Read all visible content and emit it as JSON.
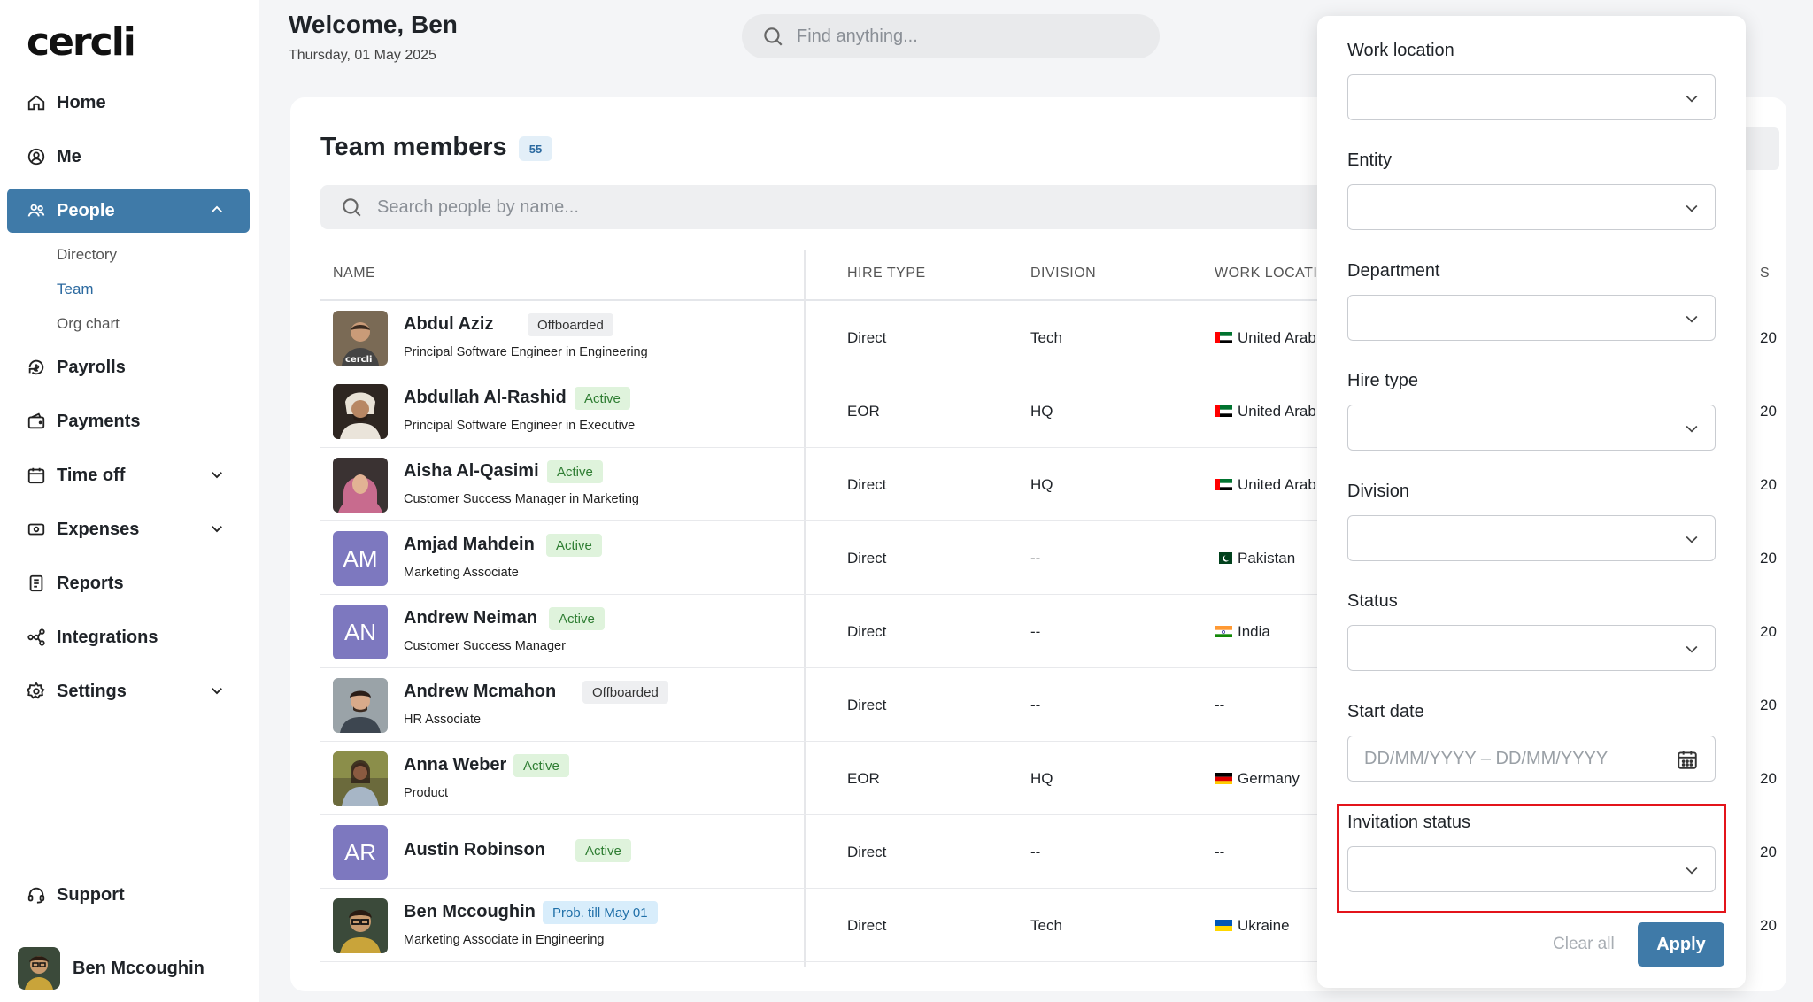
{
  "app": {
    "logo": "cercli"
  },
  "sidebar": {
    "items": [
      {
        "label": "Home",
        "icon": "home-icon"
      },
      {
        "label": "Me",
        "icon": "user-circle-icon"
      },
      {
        "label": "People",
        "icon": "people-icon"
      },
      {
        "label": "Payrolls",
        "icon": "payroll-icon"
      },
      {
        "label": "Payments",
        "icon": "wallet-icon"
      },
      {
        "label": "Time off",
        "icon": "calendar-icon"
      },
      {
        "label": "Expenses",
        "icon": "receipt-icon"
      },
      {
        "label": "Reports",
        "icon": "report-icon"
      },
      {
        "label": "Integrations",
        "icon": "integrations-icon"
      },
      {
        "label": "Settings",
        "icon": "gear-icon"
      },
      {
        "label": "Support",
        "icon": "headset-icon"
      }
    ],
    "people_sub": [
      "Directory",
      "Team",
      "Org chart"
    ],
    "user_name": "Ben Mccoughin"
  },
  "header": {
    "welcome": "Welcome, Ben",
    "date": "Thursday, 01 May 2025",
    "search_placeholder": "Find anything..."
  },
  "team": {
    "title": "Team members",
    "count": "55",
    "search_placeholder": "Search people by name...",
    "columns": [
      "NAME",
      "HIRE TYPE",
      "DIVISION",
      "WORK LOCATION",
      "S"
    ],
    "rows": [
      {
        "name": "Abdul Aziz",
        "status": "Offboarded",
        "role": "Principal Software Engineer in Engineering",
        "hire": "Direct",
        "division": "Tech",
        "location": "United Arab Emirates",
        "flag": "ae",
        "edge": "20"
      },
      {
        "name": "Abdullah Al-Rashid",
        "status": "Active",
        "role": "Principal Software Engineer in Executive",
        "hire": "EOR",
        "division": "HQ",
        "location": "United Arab Emirates",
        "flag": "ae",
        "edge": "20"
      },
      {
        "name": "Aisha Al-Qasimi",
        "status": "Active",
        "role": "Customer Success Manager in Marketing",
        "hire": "Direct",
        "division": "HQ",
        "location": "United Arab Emirates",
        "flag": "ae",
        "edge": "20"
      },
      {
        "name": "Amjad Mahdein",
        "initials": "AM",
        "status": "Active",
        "role": "Marketing Associate",
        "hire": "Direct",
        "division": "--",
        "location": "Pakistan",
        "flag": "pk",
        "edge": "20"
      },
      {
        "name": "Andrew Neiman",
        "initials": "AN",
        "status": "Active",
        "role": "Customer Success Manager",
        "hire": "Direct",
        "division": "--",
        "location": "India",
        "flag": "in",
        "edge": "20"
      },
      {
        "name": "Andrew Mcmahon",
        "status": "Offboarded",
        "role": "HR Associate",
        "hire": "Direct",
        "division": "--",
        "location": "--",
        "flag": "",
        "edge": "20"
      },
      {
        "name": "Anna Weber",
        "status": "Active",
        "role": "Product",
        "hire": "EOR",
        "division": "HQ",
        "location": "Germany",
        "flag": "de",
        "edge": "20"
      },
      {
        "name": "Austin Robinson",
        "initials": "AR",
        "status": "Active",
        "role": "",
        "hire": "Direct",
        "division": "--",
        "location": "--",
        "flag": "",
        "edge": "20"
      },
      {
        "name": "Ben Mccoughin",
        "status": "Prob. till May 01",
        "role": "Marketing Associate in Engineering",
        "hire": "Direct",
        "division": "Tech",
        "location": "Ukraine",
        "flag": "ua",
        "edge": "20"
      }
    ]
  },
  "filters": {
    "fields": [
      "Work location",
      "Entity",
      "Department",
      "Hire type",
      "Division",
      "Status",
      "Start date",
      "Invitation status"
    ],
    "date_placeholder": "DD/MM/YYYY – DD/MM/YYYY",
    "clear_label": "Clear all",
    "apply_label": "Apply"
  },
  "colors": {
    "accent": "#3f7aa8",
    "active_badge": "#dff3dc",
    "highlight": "#e3141b"
  }
}
